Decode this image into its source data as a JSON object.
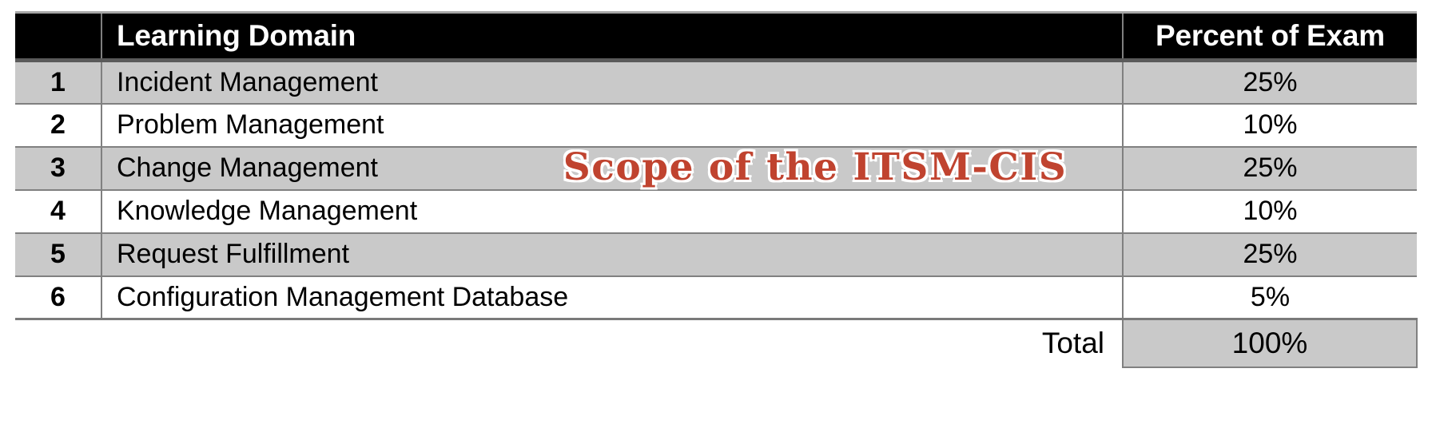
{
  "table": {
    "columns": {
      "number_header": "",
      "domain_header": "Learning Domain",
      "percent_header": "Percent of Exam"
    },
    "rows": [
      {
        "num": "1",
        "domain": "Incident Management",
        "percent": "25%"
      },
      {
        "num": "2",
        "domain": "Problem Management",
        "percent": "10%"
      },
      {
        "num": "3",
        "domain": "Change Management",
        "percent": "25%"
      },
      {
        "num": "4",
        "domain": "Knowledge Management",
        "percent": "10%"
      },
      {
        "num": "5",
        "domain": "Request Fulfillment",
        "percent": "25%"
      },
      {
        "num": "6",
        "domain": "Configuration Management Database",
        "percent": "5%"
      }
    ],
    "total": {
      "label": "Total",
      "value": "100%"
    }
  },
  "overlay": {
    "title": "Scope of the ITSM-CIS",
    "color": "#C0432F",
    "outline_color": "#FFFFFF"
  },
  "colors": {
    "header_background": "#000000",
    "header_text": "#FFFFFF",
    "row_shaded": "#C9C9C9",
    "row_plain": "#FFFFFF",
    "grid_line": "#808080",
    "body_text": "#000000"
  },
  "chart_data": {
    "type": "table",
    "title": "Scope of the ITSM-CIS",
    "columns": [
      "#",
      "Learning Domain",
      "Percent of Exam"
    ],
    "categories": [
      "Incident Management",
      "Problem Management",
      "Change Management",
      "Knowledge Management",
      "Request Fulfillment",
      "Configuration Management Database"
    ],
    "values": [
      25,
      10,
      25,
      10,
      25,
      5
    ],
    "unit": "%",
    "total": 100,
    "xlabel": "Learning Domain",
    "ylabel": "Percent of Exam"
  }
}
